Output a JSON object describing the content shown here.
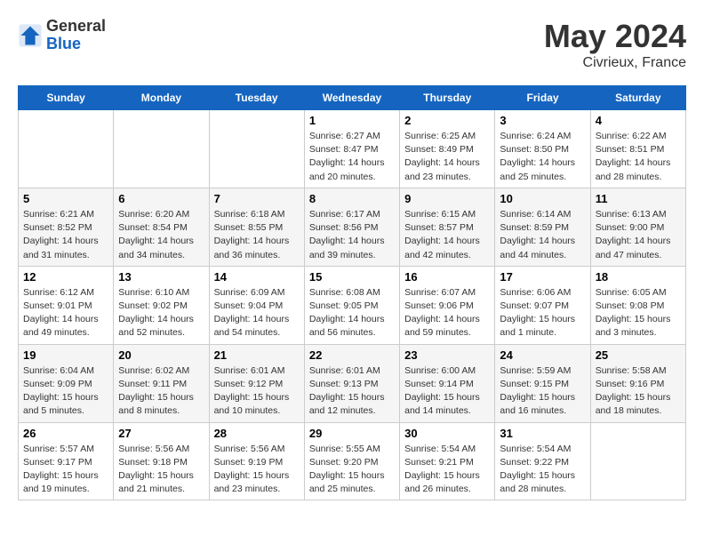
{
  "header": {
    "logo_general": "General",
    "logo_blue": "Blue",
    "title": "May 2024",
    "location": "Civrieux, France"
  },
  "weekdays": [
    "Sunday",
    "Monday",
    "Tuesday",
    "Wednesday",
    "Thursday",
    "Friday",
    "Saturday"
  ],
  "weeks": [
    [
      {
        "day": "",
        "detail": ""
      },
      {
        "day": "",
        "detail": ""
      },
      {
        "day": "",
        "detail": ""
      },
      {
        "day": "1",
        "detail": "Sunrise: 6:27 AM\nSunset: 8:47 PM\nDaylight: 14 hours\nand 20 minutes."
      },
      {
        "day": "2",
        "detail": "Sunrise: 6:25 AM\nSunset: 8:49 PM\nDaylight: 14 hours\nand 23 minutes."
      },
      {
        "day": "3",
        "detail": "Sunrise: 6:24 AM\nSunset: 8:50 PM\nDaylight: 14 hours\nand 25 minutes."
      },
      {
        "day": "4",
        "detail": "Sunrise: 6:22 AM\nSunset: 8:51 PM\nDaylight: 14 hours\nand 28 minutes."
      }
    ],
    [
      {
        "day": "5",
        "detail": "Sunrise: 6:21 AM\nSunset: 8:52 PM\nDaylight: 14 hours\nand 31 minutes."
      },
      {
        "day": "6",
        "detail": "Sunrise: 6:20 AM\nSunset: 8:54 PM\nDaylight: 14 hours\nand 34 minutes."
      },
      {
        "day": "7",
        "detail": "Sunrise: 6:18 AM\nSunset: 8:55 PM\nDaylight: 14 hours\nand 36 minutes."
      },
      {
        "day": "8",
        "detail": "Sunrise: 6:17 AM\nSunset: 8:56 PM\nDaylight: 14 hours\nand 39 minutes."
      },
      {
        "day": "9",
        "detail": "Sunrise: 6:15 AM\nSunset: 8:57 PM\nDaylight: 14 hours\nand 42 minutes."
      },
      {
        "day": "10",
        "detail": "Sunrise: 6:14 AM\nSunset: 8:59 PM\nDaylight: 14 hours\nand 44 minutes."
      },
      {
        "day": "11",
        "detail": "Sunrise: 6:13 AM\nSunset: 9:00 PM\nDaylight: 14 hours\nand 47 minutes."
      }
    ],
    [
      {
        "day": "12",
        "detail": "Sunrise: 6:12 AM\nSunset: 9:01 PM\nDaylight: 14 hours\nand 49 minutes."
      },
      {
        "day": "13",
        "detail": "Sunrise: 6:10 AM\nSunset: 9:02 PM\nDaylight: 14 hours\nand 52 minutes."
      },
      {
        "day": "14",
        "detail": "Sunrise: 6:09 AM\nSunset: 9:04 PM\nDaylight: 14 hours\nand 54 minutes."
      },
      {
        "day": "15",
        "detail": "Sunrise: 6:08 AM\nSunset: 9:05 PM\nDaylight: 14 hours\nand 56 minutes."
      },
      {
        "day": "16",
        "detail": "Sunrise: 6:07 AM\nSunset: 9:06 PM\nDaylight: 14 hours\nand 59 minutes."
      },
      {
        "day": "17",
        "detail": "Sunrise: 6:06 AM\nSunset: 9:07 PM\nDaylight: 15 hours\nand 1 minute."
      },
      {
        "day": "18",
        "detail": "Sunrise: 6:05 AM\nSunset: 9:08 PM\nDaylight: 15 hours\nand 3 minutes."
      }
    ],
    [
      {
        "day": "19",
        "detail": "Sunrise: 6:04 AM\nSunset: 9:09 PM\nDaylight: 15 hours\nand 5 minutes."
      },
      {
        "day": "20",
        "detail": "Sunrise: 6:02 AM\nSunset: 9:11 PM\nDaylight: 15 hours\nand 8 minutes."
      },
      {
        "day": "21",
        "detail": "Sunrise: 6:01 AM\nSunset: 9:12 PM\nDaylight: 15 hours\nand 10 minutes."
      },
      {
        "day": "22",
        "detail": "Sunrise: 6:01 AM\nSunset: 9:13 PM\nDaylight: 15 hours\nand 12 minutes."
      },
      {
        "day": "23",
        "detail": "Sunrise: 6:00 AM\nSunset: 9:14 PM\nDaylight: 15 hours\nand 14 minutes."
      },
      {
        "day": "24",
        "detail": "Sunrise: 5:59 AM\nSunset: 9:15 PM\nDaylight: 15 hours\nand 16 minutes."
      },
      {
        "day": "25",
        "detail": "Sunrise: 5:58 AM\nSunset: 9:16 PM\nDaylight: 15 hours\nand 18 minutes."
      }
    ],
    [
      {
        "day": "26",
        "detail": "Sunrise: 5:57 AM\nSunset: 9:17 PM\nDaylight: 15 hours\nand 19 minutes."
      },
      {
        "day": "27",
        "detail": "Sunrise: 5:56 AM\nSunset: 9:18 PM\nDaylight: 15 hours\nand 21 minutes."
      },
      {
        "day": "28",
        "detail": "Sunrise: 5:56 AM\nSunset: 9:19 PM\nDaylight: 15 hours\nand 23 minutes."
      },
      {
        "day": "29",
        "detail": "Sunrise: 5:55 AM\nSunset: 9:20 PM\nDaylight: 15 hours\nand 25 minutes."
      },
      {
        "day": "30",
        "detail": "Sunrise: 5:54 AM\nSunset: 9:21 PM\nDaylight: 15 hours\nand 26 minutes."
      },
      {
        "day": "31",
        "detail": "Sunrise: 5:54 AM\nSunset: 9:22 PM\nDaylight: 15 hours\nand 28 minutes."
      },
      {
        "day": "",
        "detail": ""
      }
    ]
  ]
}
